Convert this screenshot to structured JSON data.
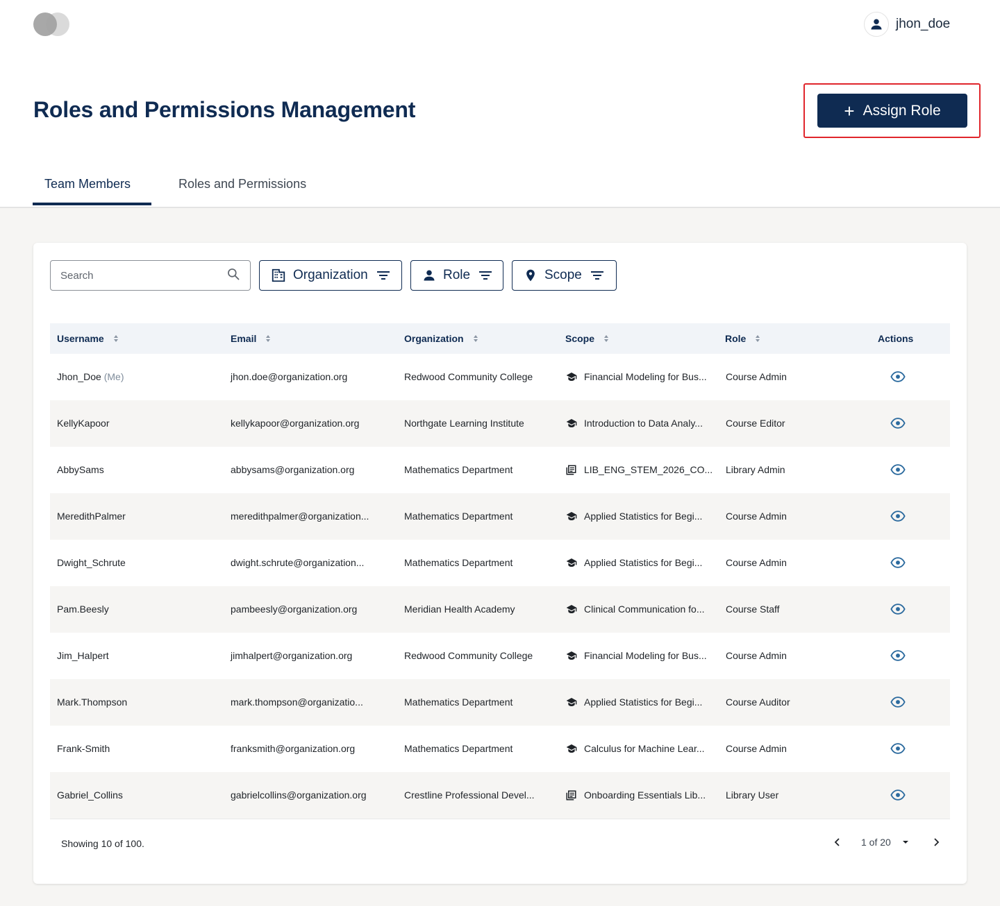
{
  "header": {
    "user_name": "jhon_doe",
    "user_icon": "person-icon"
  },
  "page": {
    "title": "Roles and Permissions Management",
    "assign_label": "Assign Role"
  },
  "tabs": [
    {
      "label": "Team Members",
      "active": true
    },
    {
      "label": "Roles and Permissions",
      "active": false
    }
  ],
  "filters": {
    "search_placeholder": "Search",
    "organization": "Organization",
    "role": "Role",
    "scope": "Scope"
  },
  "table": {
    "columns": [
      "Username",
      "Email",
      "Organization",
      "Scope",
      "Role",
      "Actions"
    ],
    "me_tag": "(Me)",
    "rows": [
      {
        "username": "Jhon_Doe",
        "email": "jhon.doe@organization.org",
        "organization": "Redwood Community College",
        "scope_icon": "graduation-cap-icon",
        "scope": "Financial Modeling for Bus...",
        "role": "Course Admin"
      },
      {
        "username": "KellyKapoor",
        "email": "kellykapoor@organization.org",
        "organization": "Northgate Learning Institute",
        "scope_icon": "graduation-cap-icon",
        "scope": "Introduction to Data Analy...",
        "role": "Course Editor"
      },
      {
        "username": "AbbySams",
        "email": "abbysams@organization.org",
        "organization": "Mathematics Department",
        "scope_icon": "library-icon",
        "scope": "LIB_ENG_STEM_2026_CO...",
        "role": "Library Admin"
      },
      {
        "username": "MeredithPalmer",
        "email": "meredithpalmer@organization...",
        "organization": "Mathematics Department",
        "scope_icon": "graduation-cap-icon",
        "scope": "Applied Statistics for Begi...",
        "role": "Course Admin"
      },
      {
        "username": "Dwight_Schrute",
        "email": "dwight.schrute@organization...",
        "organization": "Mathematics Department",
        "scope_icon": "graduation-cap-icon",
        "scope": "Applied Statistics for Begi...",
        "role": "Course Admin"
      },
      {
        "username": "Pam.Beesly",
        "email": "pambeesly@organization.org",
        "organization": "Meridian Health Academy",
        "scope_icon": "graduation-cap-icon",
        "scope": "Clinical Communication fo...",
        "role": "Course Staff"
      },
      {
        "username": "Jim_Halpert",
        "email": "jimhalpert@organization.org",
        "organization": "Redwood Community College",
        "scope_icon": "graduation-cap-icon",
        "scope": "Financial Modeling for Bus...",
        "role": "Course Admin"
      },
      {
        "username": "Mark.Thompson",
        "email": "mark.thompson@organizatio...",
        "organization": "Mathematics Department",
        "scope_icon": "graduation-cap-icon",
        "scope": "Applied Statistics for Begi...",
        "role": "Course Auditor"
      },
      {
        "username": "Frank-Smith",
        "email": "franksmith@organization.org",
        "organization": "Mathematics Department",
        "scope_icon": "graduation-cap-icon",
        "scope": "Calculus for Machine Lear...",
        "role": "Course Admin"
      },
      {
        "username": "Gabriel_Collins",
        "email": "gabrielcollins@organization.org",
        "organization": "Crestline Professional Devel...",
        "scope_icon": "library-icon",
        "scope": "Onboarding Essentials Lib...",
        "role": "Library User"
      }
    ]
  },
  "footer": {
    "showing": "Showing 10 of 100.",
    "page": "1 of 20"
  },
  "colors": {
    "primary": "#0f2b52",
    "highlight": "#e0252b",
    "eye": "#2b6a9e",
    "alt_row": "#f6f5f3"
  }
}
